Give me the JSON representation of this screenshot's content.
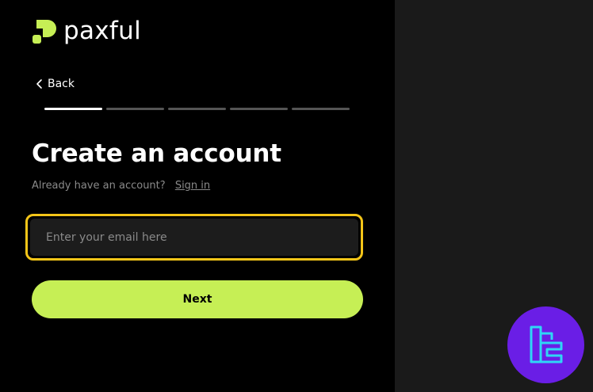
{
  "brand": {
    "name": "paxful",
    "accent_color": "#c6ef55"
  },
  "nav": {
    "back_label": "Back"
  },
  "progress": {
    "total_steps": 5,
    "current_step": 1
  },
  "form": {
    "title": "Create an account",
    "signin_prompt": "Already have an account?",
    "signin_link": "Sign in",
    "email_placeholder": "Enter your email here",
    "email_value": "",
    "focus_color": "#f4c518",
    "next_label": "Next"
  },
  "watermark": {
    "icon": "tc-logo-icon",
    "color": "#6a1ee6"
  }
}
